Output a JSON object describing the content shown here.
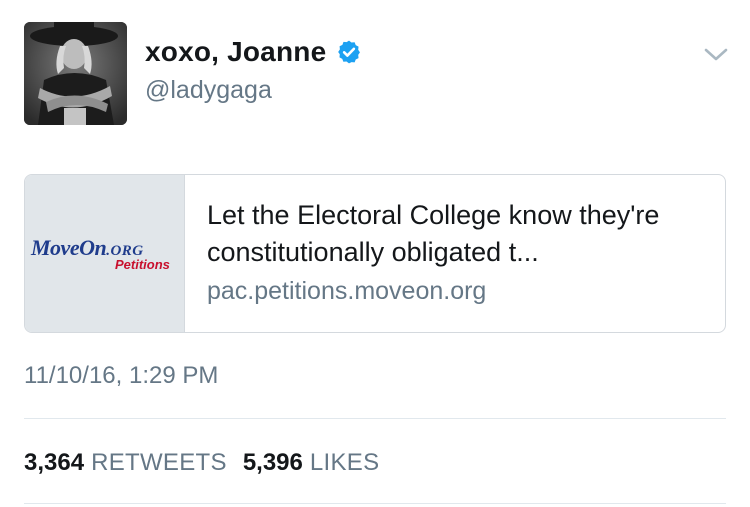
{
  "tweet": {
    "display_name": "xoxo, Joanne",
    "handle": "@ladygaga",
    "verified": true,
    "timestamp": "11/10/16, 1:29 PM"
  },
  "card": {
    "title": "Let the Electoral College know they're constitutionally obligated t...",
    "url": "pac.petitions.moveon.org",
    "logo_main": "MoveOn",
    "logo_org": ".ORG",
    "logo_sub": "Petitions"
  },
  "stats": {
    "retweets_count": "3,364",
    "retweets_label": "RETWEETS",
    "likes_count": "5,396",
    "likes_label": "LIKES"
  },
  "icons": {
    "verified": "verified-badge-icon",
    "menu": "chevron-down-icon"
  },
  "colors": {
    "verified_blue": "#1da1f2",
    "secondary_text": "#657786",
    "logo_blue": "#1f3c8c",
    "logo_red": "#c8102e"
  }
}
